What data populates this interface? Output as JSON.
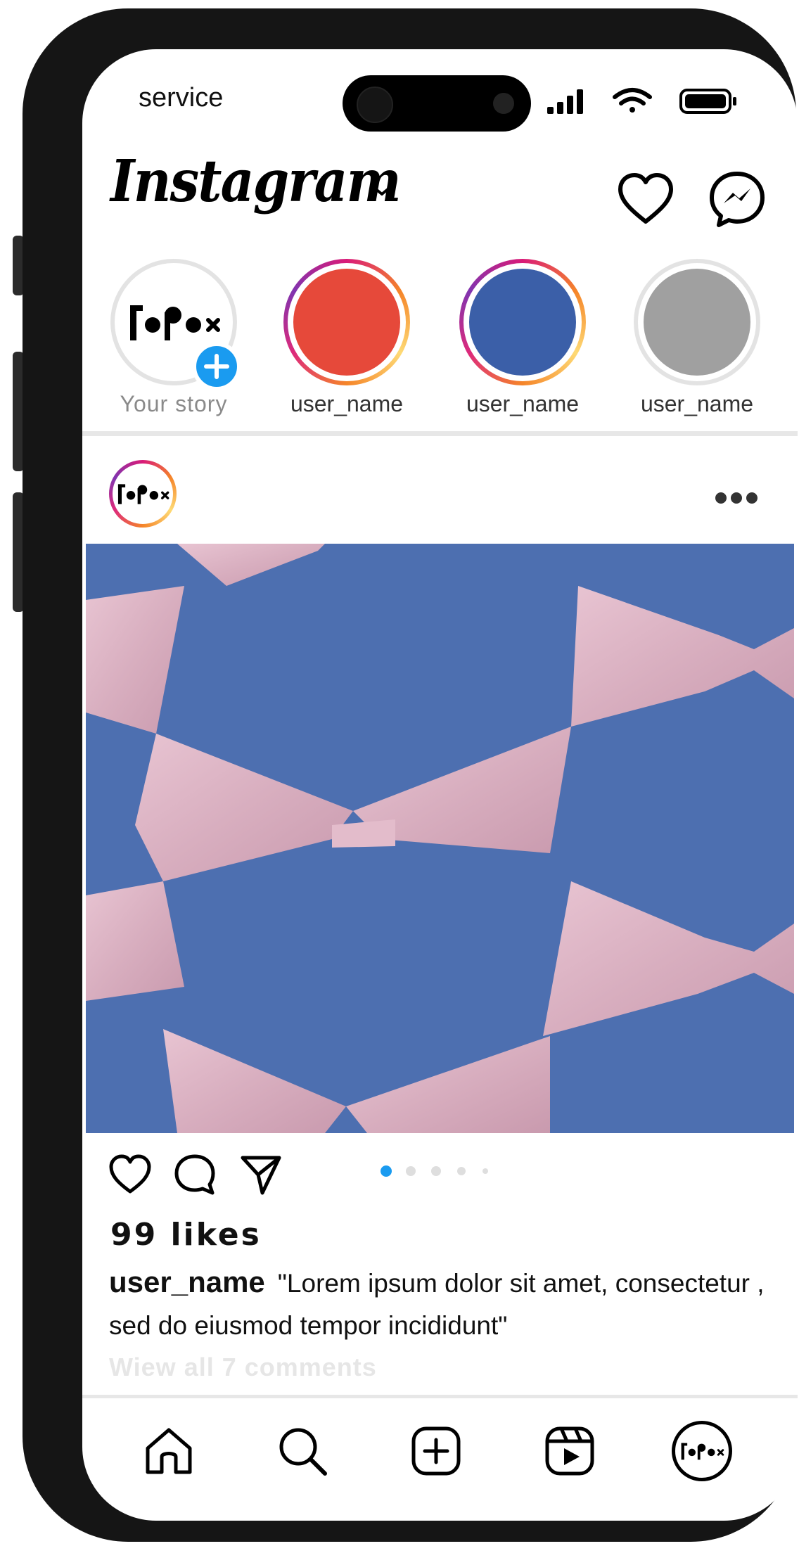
{
  "status_bar": {
    "carrier": "service"
  },
  "header": {
    "logo_text": "Instagram",
    "icons": [
      "chevron-down-icon",
      "heart-icon",
      "messenger-icon"
    ]
  },
  "profile_logo": {
    "text": "[•P•x"
  },
  "stories": [
    {
      "label": "Your story",
      "kind": "own",
      "color": "#ffffff"
    },
    {
      "label": "user_name",
      "kind": "gradient-ring",
      "color": "#e6493a"
    },
    {
      "label": "user_name",
      "kind": "gradient-ring",
      "color": "#3b5fa8"
    },
    {
      "label": "user_name",
      "kind": "grey-ring",
      "color": "#a0a0a0"
    }
  ],
  "post": {
    "likes": "99 likes",
    "username": "user_name",
    "caption_line1": "\"Lorem ipsum dolor sit amet, consectetur ,",
    "caption_line2": "sed do eiusmod tempor incididunt\"",
    "comments_link": "Wiew all 7 comments",
    "carousel": {
      "count": 5,
      "active_index": 0
    },
    "image": {
      "background": "#4d6fb0",
      "ribbon": "#dcb3c3",
      "subject": "pink satin bow ribbons on blue background"
    }
  },
  "nav": {
    "items": [
      "home-icon",
      "search-icon",
      "create-icon",
      "reels-icon",
      "profile-avatar-icon"
    ]
  },
  "colors": {
    "accent_blue": "#1a9bf0",
    "text": "#111111",
    "muted": "#8a8a8a"
  }
}
